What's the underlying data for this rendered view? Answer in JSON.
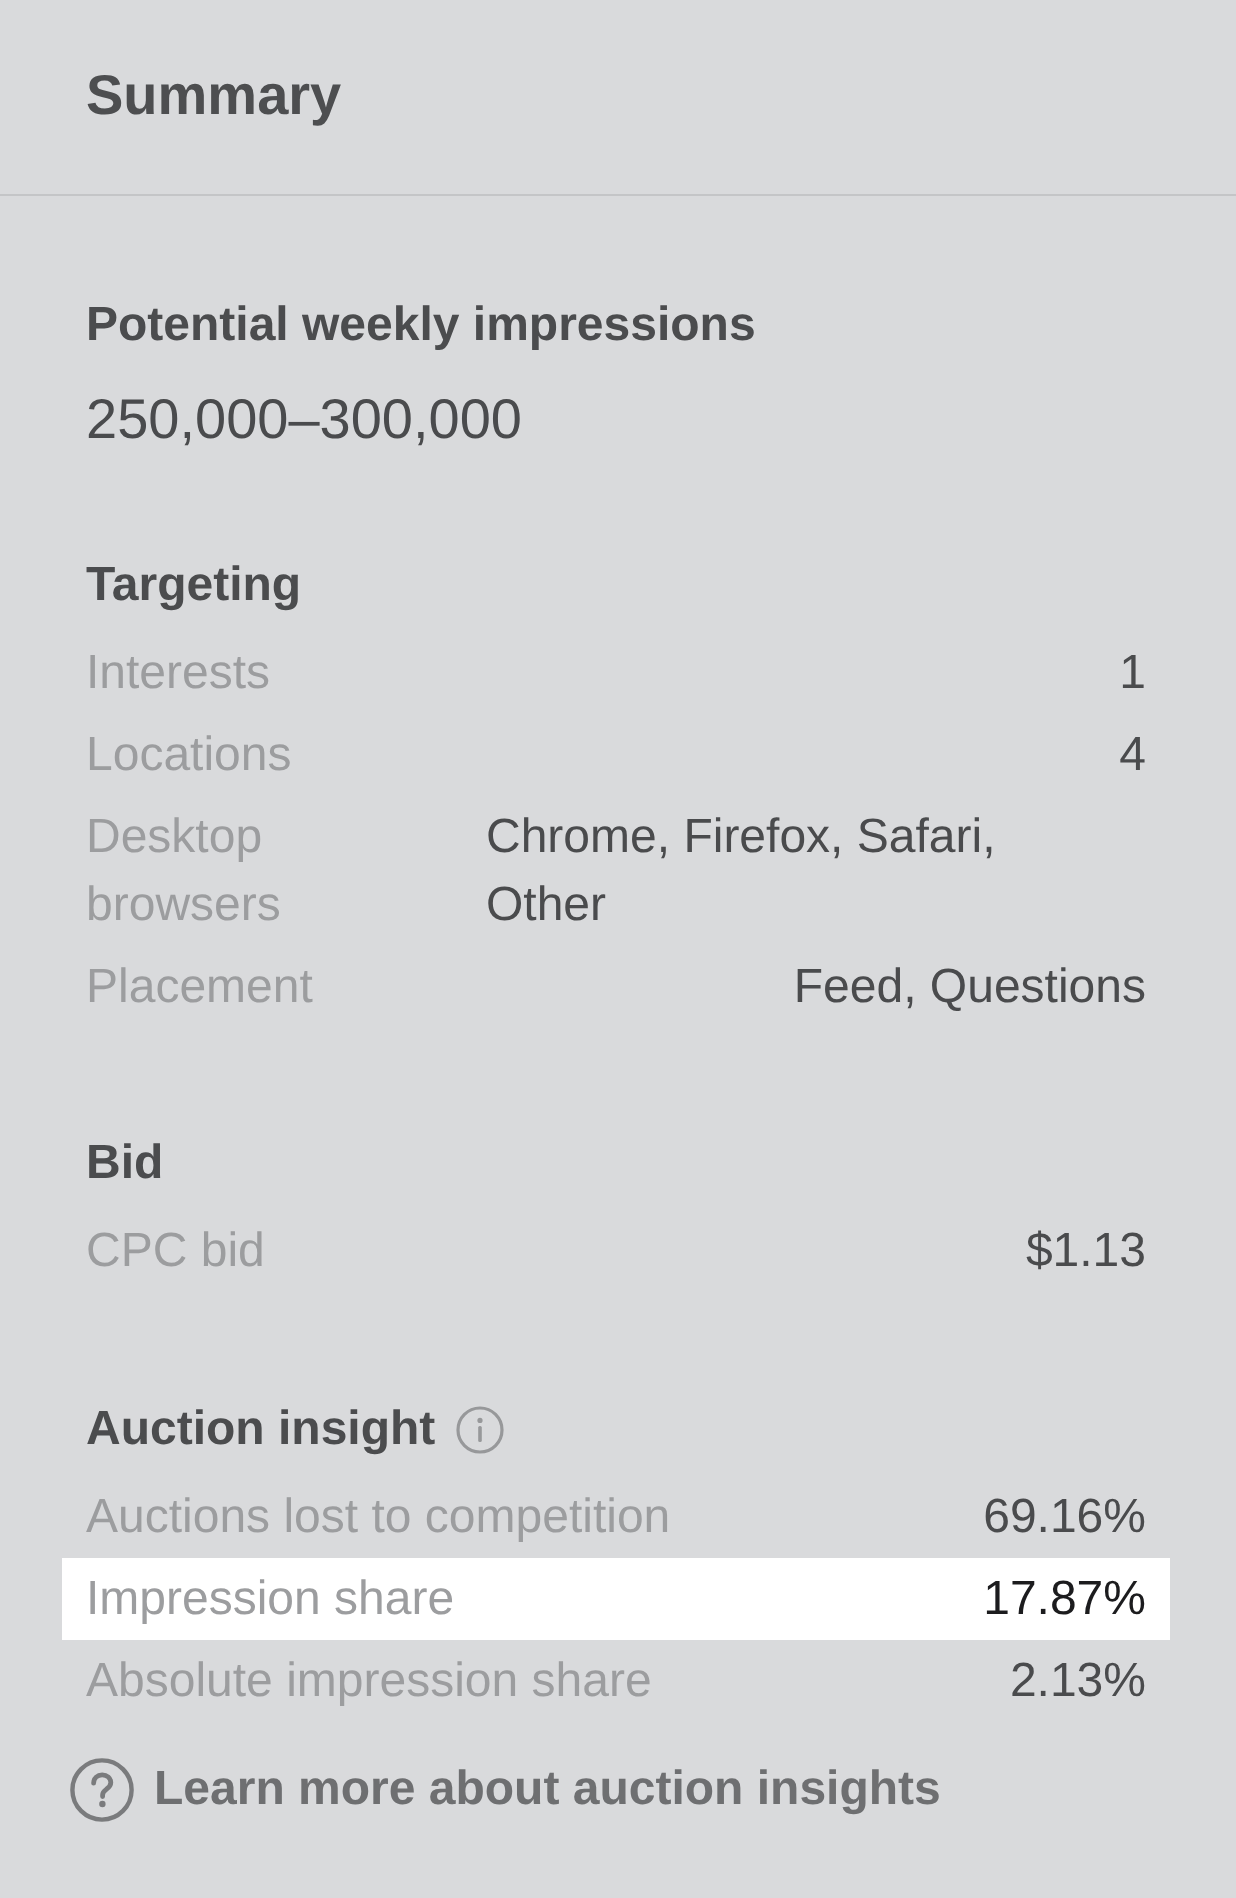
{
  "panel": {
    "title": "Summary"
  },
  "impressions": {
    "heading": "Potential weekly impressions",
    "value": "250,000–300,000"
  },
  "targeting": {
    "heading": "Targeting",
    "rows": [
      {
        "label": "Interests",
        "value": "1",
        "kind": "single"
      },
      {
        "label": "Locations",
        "value": "4",
        "kind": "single"
      },
      {
        "label": "Desktop browsers",
        "value": "Chrome, Firefox, Safari, Other",
        "kind": "list"
      },
      {
        "label": "Placement",
        "value": "Feed, Questions",
        "kind": "single"
      }
    ]
  },
  "bid": {
    "heading": "Bid",
    "rows": [
      {
        "label": "CPC bid",
        "value": "$1.13",
        "kind": "single"
      }
    ]
  },
  "auction_insight": {
    "heading": "Auction insight",
    "rows": [
      {
        "label": "Auctions lost to competition",
        "value": "69.16%",
        "selected": false
      },
      {
        "label": "Impression share",
        "value": "17.87%",
        "selected": true
      },
      {
        "label": "Absolute impression share",
        "value": "2.13%",
        "selected": false
      }
    ]
  },
  "help_link": {
    "label": "Learn more about auction insights"
  }
}
